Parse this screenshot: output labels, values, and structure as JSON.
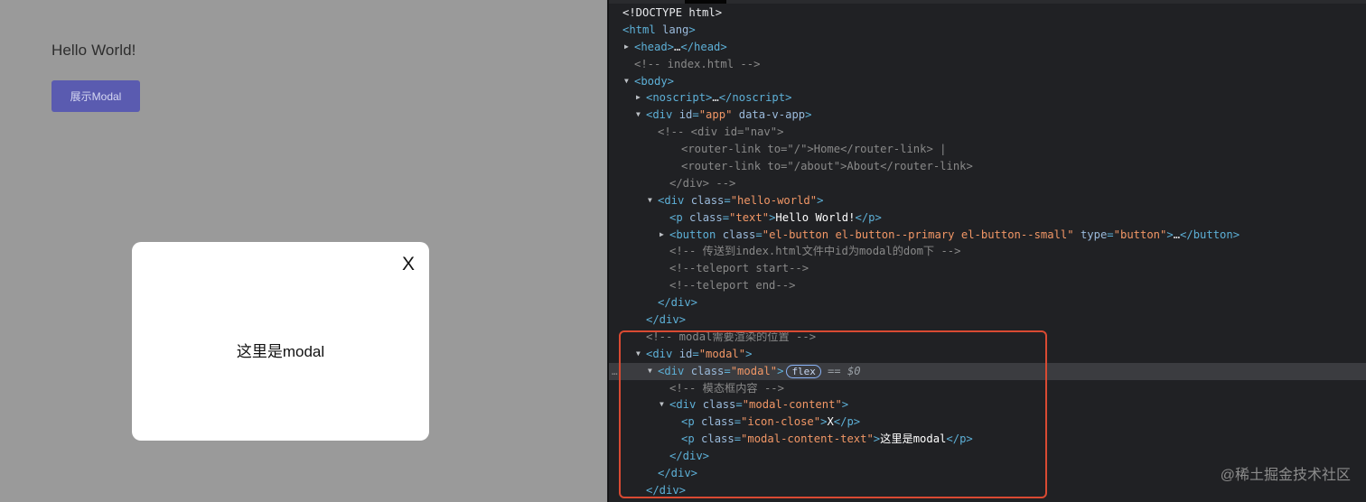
{
  "app": {
    "hello_text": "Hello World!",
    "show_button_label": "展示Modal",
    "modal": {
      "close_label": "X",
      "content_text": "这里是modal"
    }
  },
  "devtools": {
    "selected_badge": "flex",
    "selected_ref": "== $0",
    "dots": "…",
    "watermark": "@稀土掘金技术社区",
    "dom_lines": [
      {
        "indent": 0,
        "tri": "",
        "parts": [
          [
            "doctype",
            "<!DOCTYPE html>"
          ]
        ]
      },
      {
        "indent": 0,
        "tri": "",
        "parts": [
          [
            "tag",
            "<html "
          ],
          [
            "attr",
            "lang"
          ],
          [
            "tag",
            ">"
          ]
        ]
      },
      {
        "indent": 1,
        "tri": "▶",
        "parts": [
          [
            "tag",
            "<head>"
          ],
          [
            "txt",
            "…"
          ],
          [
            "tag",
            "</head>"
          ]
        ]
      },
      {
        "indent": 1,
        "tri": "",
        "parts": [
          [
            "com",
            "<!-- index.html -->"
          ]
        ]
      },
      {
        "indent": 1,
        "tri": "▼",
        "parts": [
          [
            "tag",
            "<body>"
          ]
        ]
      },
      {
        "indent": 2,
        "tri": "▶",
        "parts": [
          [
            "tag",
            "<noscript>"
          ],
          [
            "txt",
            "…"
          ],
          [
            "tag",
            "</noscript>"
          ]
        ]
      },
      {
        "indent": 2,
        "tri": "▼",
        "parts": [
          [
            "tag",
            "<div "
          ],
          [
            "attr",
            "id"
          ],
          [
            "tag",
            "="
          ],
          [
            "val",
            "\"app\""
          ],
          [
            "attr",
            " data-v-app"
          ],
          [
            "tag",
            ">"
          ]
        ]
      },
      {
        "indent": 3,
        "tri": "",
        "parts": [
          [
            "com",
            "<!-- <div id=\"nav\">"
          ]
        ]
      },
      {
        "indent": 5,
        "tri": "",
        "parts": [
          [
            "com",
            "<router-link to=\"/\">Home</router-link> |"
          ]
        ]
      },
      {
        "indent": 5,
        "tri": "",
        "parts": [
          [
            "com",
            "<router-link to=\"/about\">About</router-link>"
          ]
        ]
      },
      {
        "indent": 4,
        "tri": "",
        "parts": [
          [
            "com",
            "</div> -->"
          ]
        ]
      },
      {
        "indent": 3,
        "tri": "▼",
        "parts": [
          [
            "tag",
            "<div "
          ],
          [
            "attr",
            "class"
          ],
          [
            "tag",
            "="
          ],
          [
            "val",
            "\"hello-world\""
          ],
          [
            "tag",
            ">"
          ]
        ]
      },
      {
        "indent": 4,
        "tri": "",
        "parts": [
          [
            "tag",
            "<p "
          ],
          [
            "attr",
            "class"
          ],
          [
            "tag",
            "="
          ],
          [
            "val",
            "\"text\""
          ],
          [
            "tag",
            ">"
          ],
          [
            "txt-strong",
            "Hello World!"
          ],
          [
            "tag",
            "</p>"
          ]
        ]
      },
      {
        "indent": 4,
        "tri": "▶",
        "parts": [
          [
            "tag",
            "<button "
          ],
          [
            "attr",
            "class"
          ],
          [
            "tag",
            "="
          ],
          [
            "val",
            "\"el-button el-button--primary el-button--small\""
          ],
          [
            "attr",
            " type"
          ],
          [
            "tag",
            "="
          ],
          [
            "val",
            "\"button\""
          ],
          [
            "tag",
            ">"
          ],
          [
            "txt",
            "…"
          ],
          [
            "tag",
            "</button>"
          ]
        ]
      },
      {
        "indent": 4,
        "tri": "",
        "parts": [
          [
            "com",
            "<!-- 传送到index.html文件中id为modal的dom下 -->"
          ]
        ]
      },
      {
        "indent": 4,
        "tri": "",
        "parts": [
          [
            "com",
            "<!--teleport start-->"
          ]
        ]
      },
      {
        "indent": 4,
        "tri": "",
        "parts": [
          [
            "com",
            "<!--teleport end-->"
          ]
        ]
      },
      {
        "indent": 3,
        "tri": "",
        "parts": [
          [
            "tag",
            "</div>"
          ]
        ]
      },
      {
        "indent": 2,
        "tri": "",
        "parts": [
          [
            "tag",
            "</div>"
          ]
        ]
      },
      {
        "indent": 2,
        "tri": "",
        "parts": [
          [
            "com",
            "<!-- modal需要渲染的位置 -->"
          ]
        ]
      },
      {
        "indent": 2,
        "tri": "▼",
        "parts": [
          [
            "tag",
            "<div "
          ],
          [
            "attr",
            "id"
          ],
          [
            "tag",
            "="
          ],
          [
            "val",
            "\"modal\""
          ],
          [
            "tag",
            ">"
          ]
        ]
      },
      {
        "indent": 3,
        "tri": "▼",
        "selected": true,
        "parts": [
          [
            "tag",
            "<div "
          ],
          [
            "attr",
            "class"
          ],
          [
            "tag",
            "="
          ],
          [
            "val",
            "\"modal\""
          ],
          [
            "tag",
            ">"
          ]
        ]
      },
      {
        "indent": 4,
        "tri": "",
        "parts": [
          [
            "com",
            "<!-- 模态框内容 -->"
          ]
        ]
      },
      {
        "indent": 4,
        "tri": "▼",
        "parts": [
          [
            "tag",
            "<div "
          ],
          [
            "attr",
            "class"
          ],
          [
            "tag",
            "="
          ],
          [
            "val",
            "\"modal-content\""
          ],
          [
            "tag",
            ">"
          ]
        ]
      },
      {
        "indent": 5,
        "tri": "",
        "parts": [
          [
            "tag",
            "<p "
          ],
          [
            "attr",
            "class"
          ],
          [
            "tag",
            "="
          ],
          [
            "val",
            "\"icon-close\""
          ],
          [
            "tag",
            ">"
          ],
          [
            "txt-strong",
            "X"
          ],
          [
            "tag",
            "</p>"
          ]
        ]
      },
      {
        "indent": 5,
        "tri": "",
        "parts": [
          [
            "tag",
            "<p "
          ],
          [
            "attr",
            "class"
          ],
          [
            "tag",
            "="
          ],
          [
            "val",
            "\"modal-content-text\""
          ],
          [
            "tag",
            ">"
          ],
          [
            "txt-strong",
            "这里是modal"
          ],
          [
            "tag",
            "</p>"
          ]
        ]
      },
      {
        "indent": 4,
        "tri": "",
        "parts": [
          [
            "tag",
            "</div>"
          ]
        ]
      },
      {
        "indent": 3,
        "tri": "",
        "parts": [
          [
            "tag",
            "</div>"
          ]
        ]
      },
      {
        "indent": 2,
        "tri": "",
        "parts": [
          [
            "tag",
            "</div>"
          ]
        ]
      }
    ]
  }
}
